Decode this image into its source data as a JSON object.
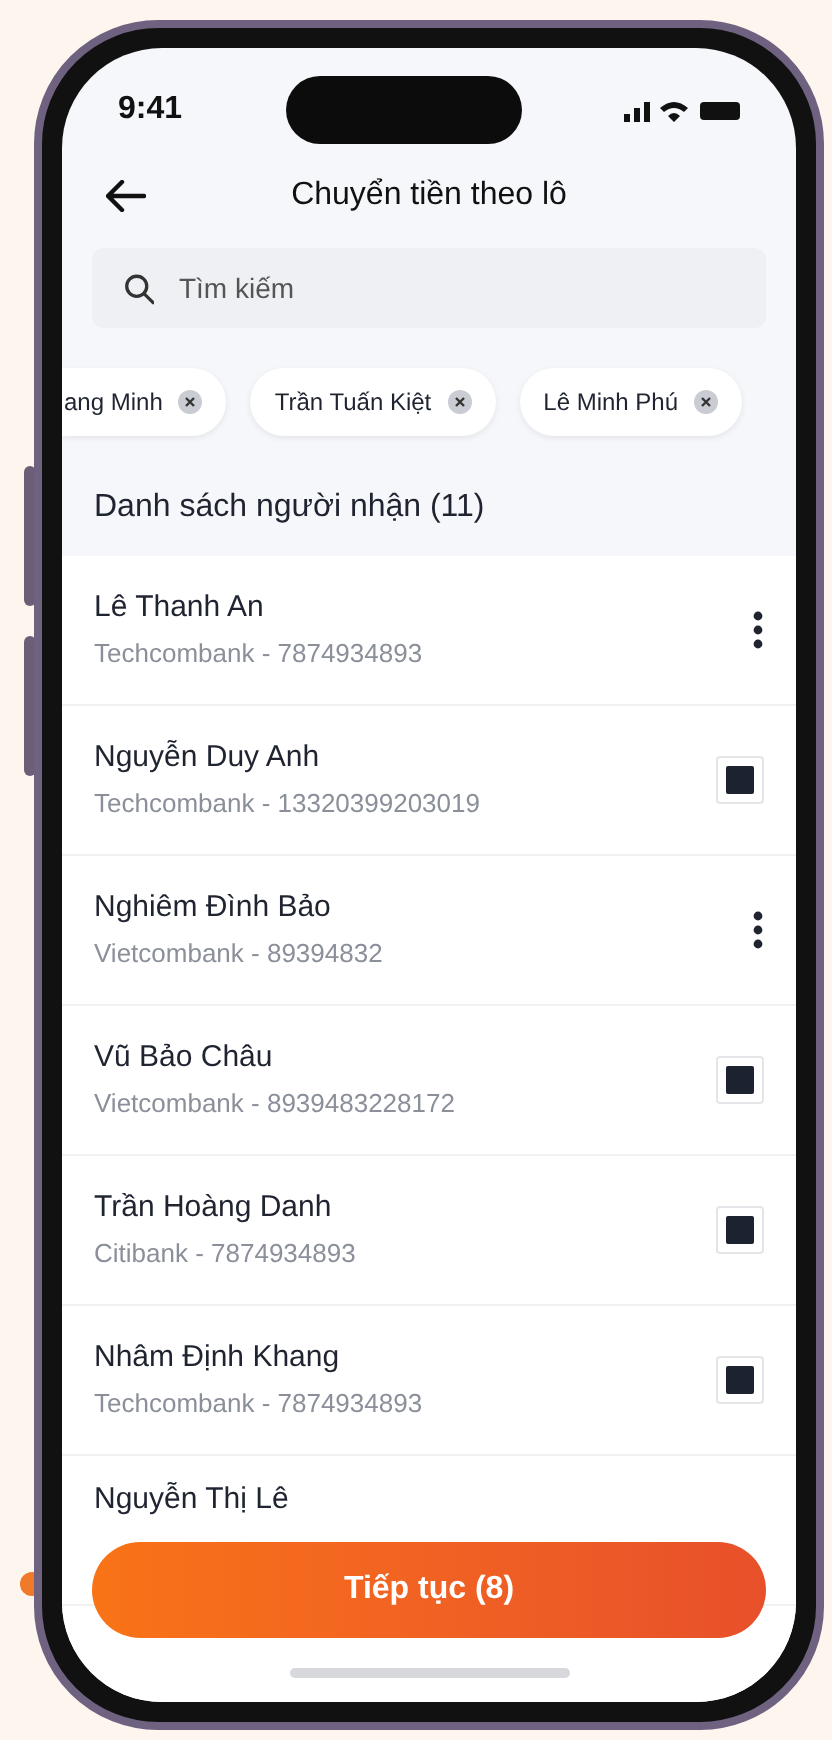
{
  "status_bar": {
    "time": "9:41"
  },
  "header": {
    "title": "Chuyển tiền theo lô"
  },
  "search": {
    "placeholder": "Tìm kiếm"
  },
  "chips": [
    {
      "label": "ang Minh"
    },
    {
      "label": "Trần Tuấn Kiệt"
    },
    {
      "label": "Lê Minh Phú"
    }
  ],
  "list_title": "Danh sách người nhận (11)",
  "recipients": [
    {
      "name": "Lê Thanh An",
      "account": "Techcombank - 7874934893",
      "kind": "menu"
    },
    {
      "name": "Nguyễn Duy Anh",
      "account": "Techcombank - 13320399203019",
      "kind": "checkbox",
      "checked": true
    },
    {
      "name": "Nghiêm Đình Bảo",
      "account": "Vietcombank - 89394832",
      "kind": "menu"
    },
    {
      "name": "Vũ Bảo Châu",
      "account": "Vietcombank - 8939483228172",
      "kind": "checkbox",
      "checked": true
    },
    {
      "name": "Trần Hoàng Danh",
      "account": "Citibank - 7874934893",
      "kind": "checkbox",
      "checked": true
    },
    {
      "name": "Nhâm Định Khang",
      "account": "Techcombank - 7874934893",
      "kind": "checkbox",
      "checked": true
    },
    {
      "name": "Nguyễn Thị Lê",
      "kind": "partial"
    }
  ],
  "continue_button": "Tiếp tục (8)"
}
